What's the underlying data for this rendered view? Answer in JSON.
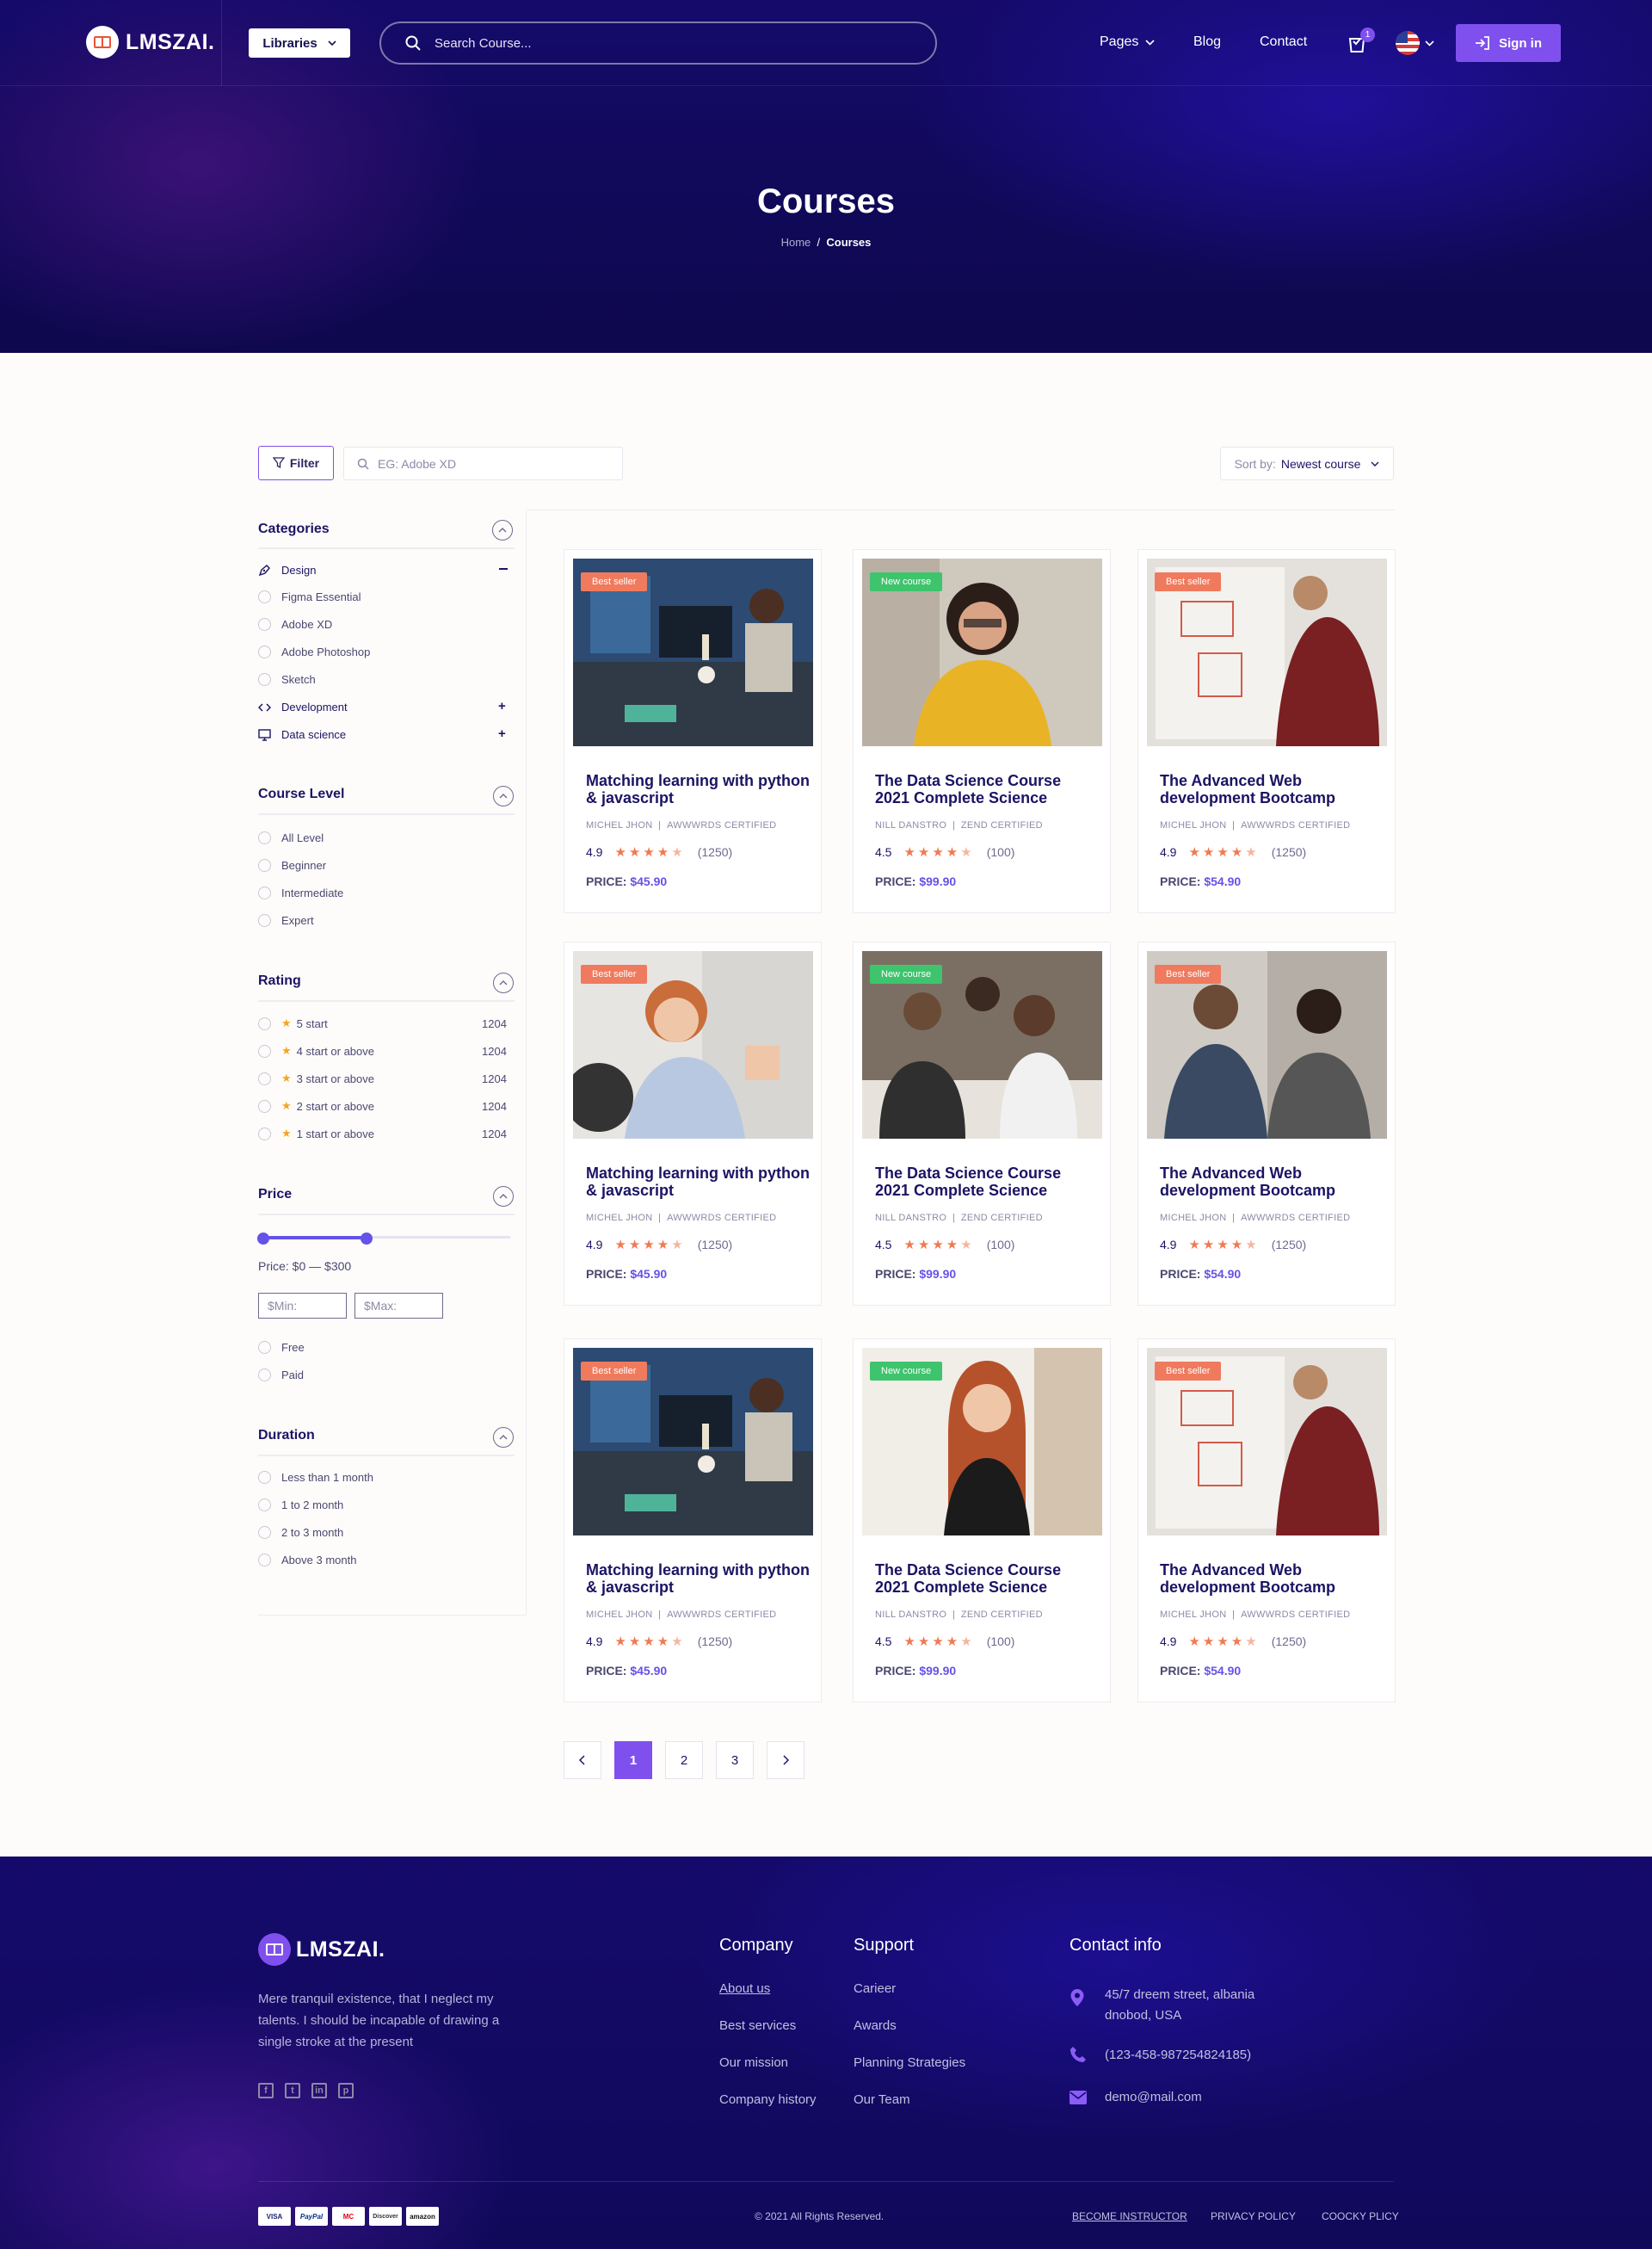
{
  "brand": {
    "name": "LMSZAI."
  },
  "header": {
    "libraries_label": "Libraries",
    "search_placeholder": "Search Course...",
    "nav": {
      "pages": "Pages",
      "blog": "Blog",
      "contact": "Contact"
    },
    "cart_count": "1",
    "signin_label": "Sign in"
  },
  "hero": {
    "title": "Courses",
    "breadcrumb_home": "Home",
    "breadcrumb_sep": "/",
    "breadcrumb_current": "Courses"
  },
  "toolbar": {
    "filter_label": "Filter",
    "keyword_placeholder": "EG: Adobe XD",
    "sort_prefix": "Sort by:",
    "sort_value": "Newest course"
  },
  "sidebar": {
    "categories": {
      "title": "Categories",
      "items": [
        "Design",
        "Figma Essential",
        "Adobe XD",
        "Adobe Photoshop",
        "Sketch",
        "Development",
        "Data science"
      ]
    },
    "level": {
      "title": "Course Level",
      "items": [
        "All Level",
        "Beginner",
        "Intermediate",
        "Expert"
      ]
    },
    "rating": {
      "title": "Rating",
      "items": [
        {
          "label": "5 start",
          "count": "1204"
        },
        {
          "label": "4 start or above",
          "count": "1204"
        },
        {
          "label": "3 start or above",
          "count": "1204"
        },
        {
          "label": "2 start or above",
          "count": "1204"
        },
        {
          "label": "1 start or above",
          "count": "1204"
        }
      ]
    },
    "price": {
      "title": "Price",
      "range_text": "Price: $0 — $300",
      "min_placeholder": "$Min:",
      "max_placeholder": "$Max:",
      "options": [
        "Free",
        "Paid"
      ]
    },
    "duration": {
      "title": "Duration",
      "items": [
        "Less than 1 month",
        "1 to 2 month",
        "2 to 3 month",
        "Above 3 month"
      ]
    }
  },
  "courses": [
    {
      "tag": "Best seller",
      "tag_color": "#f07a5d",
      "title": "Matching learning with python & javascript",
      "author": "MICHEL JHON",
      "cert": "AWWWRDS CERTIFIED",
      "rating": "4.9",
      "count": "(1250)",
      "price_label": "PRICE:",
      "price": "$45.90",
      "image": "man-at-computer"
    },
    {
      "tag": "New course",
      "tag_color": "#3ec46d",
      "title": "The Data Science Course 2021 Complete Science",
      "author": "NILL DANSTRO",
      "cert": "ZEND CERTIFIED",
      "rating": "4.5",
      "count": "(100)",
      "price_label": "PRICE:",
      "price": "$99.90",
      "image": "woman-yellow-sweater"
    },
    {
      "tag": "Best seller",
      "tag_color": "#f07a5d",
      "title": "The Advanced Web development Bootcamp",
      "author": "MICHEL JHON",
      "cert": "AWWWRDS CERTIFIED",
      "rating": "4.9",
      "count": "(1250)",
      "price_label": "PRICE:",
      "price": "$54.90",
      "image": "man-whiteboard"
    },
    {
      "tag": "Best seller",
      "tag_color": "#f07a5d",
      "title": "Matching learning with python & javascript",
      "author": "MICHEL JHON",
      "cert": "AWWWRDS CERTIFIED",
      "rating": "4.9",
      "count": "(1250)",
      "price_label": "PRICE:",
      "price": "$45.90",
      "image": "woman-talking"
    },
    {
      "tag": "New course",
      "tag_color": "#3ec46d",
      "title": "The Data Science Course 2021 Complete Science",
      "author": "NILL DANSTRO",
      "cert": "ZEND CERTIFIED",
      "rating": "4.5",
      "count": "(100)",
      "price_label": "PRICE:",
      "price": "$99.90",
      "image": "team-meeting"
    },
    {
      "tag": "Best seller",
      "tag_color": "#f07a5d",
      "title": "The Advanced Web development Bootcamp",
      "author": "MICHEL JHON",
      "cert": "AWWWRDS CERTIFIED",
      "rating": "4.9",
      "count": "(1250)",
      "price_label": "PRICE:",
      "price": "$54.90",
      "image": "couple-laptop"
    },
    {
      "tag": "Best seller",
      "tag_color": "#f07a5d",
      "title": "Matching learning with python & javascript",
      "author": "MICHEL JHON",
      "cert": "AWWWRDS CERTIFIED",
      "rating": "4.9",
      "count": "(1250)",
      "price_label": "PRICE:",
      "price": "$45.90",
      "image": "man-at-computer"
    },
    {
      "tag": "New course",
      "tag_color": "#3ec46d",
      "title": "The Data Science Course 2021 Complete Science",
      "author": "NILL DANSTRO",
      "cert": "ZEND CERTIFIED",
      "rating": "4.5",
      "count": "(100)",
      "price_label": "PRICE:",
      "price": "$99.90",
      "image": "woman-smiling"
    },
    {
      "tag": "Best seller",
      "tag_color": "#f07a5d",
      "title": "The Advanced Web development Bootcamp",
      "author": "MICHEL JHON",
      "cert": "AWWWRDS CERTIFIED",
      "rating": "4.9",
      "count": "(1250)",
      "price_label": "PRICE:",
      "price": "$54.90",
      "image": "man-whiteboard"
    }
  ],
  "pagination": {
    "pages": [
      "1",
      "2",
      "3"
    ],
    "current": "1"
  },
  "footer": {
    "description": "Mere tranquil existence, that I neglect my talents. I should be incapable of drawing a single stroke at the present",
    "company": {
      "title": "Company",
      "links": [
        "About us",
        "Best services",
        "Our mission",
        "Company history"
      ]
    },
    "support": {
      "title": "Support",
      "links": [
        "Carieer",
        "Awards",
        "Planning Strategies",
        "Our Team"
      ]
    },
    "contact": {
      "title": "Contact info",
      "address": "45/7 dreem street, albania dnobod, USA",
      "phone": "(123-458-987254824185)",
      "email": "demo@mail.com"
    },
    "payments": [
      "VISA",
      "PayPal",
      "MC",
      "Discover",
      "amazon"
    ],
    "copyright": "© 2021  All Rights Reserved.",
    "bottom_links": [
      "BECOME INSTRUCTOR",
      "PRIVACY POLICY",
      "COOCKY PLICY"
    ]
  },
  "colors": {
    "accent": "#7f50ee",
    "price": "#6552e8",
    "best_seller": "#f07a5d",
    "new_course": "#3ec46d",
    "navy": "#1b1464"
  }
}
